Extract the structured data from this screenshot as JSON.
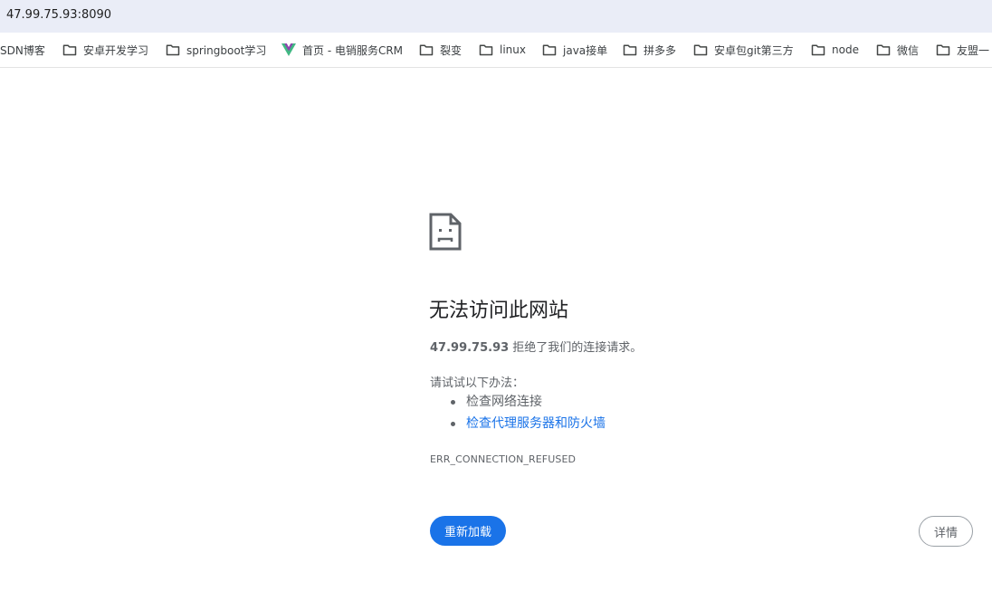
{
  "address_bar": {
    "url": "47.99.75.93:8090"
  },
  "bookmarks": [
    {
      "label": "SDN博客",
      "icon": "none"
    },
    {
      "label": "安卓开发学习",
      "icon": "folder-icon"
    },
    {
      "label": "springboot学习",
      "icon": "folder-icon"
    },
    {
      "label": "首页 - 电销服务CRM",
      "icon": "vue-logo-icon"
    },
    {
      "label": "裂变",
      "icon": "folder-icon"
    },
    {
      "label": "linux",
      "icon": "folder-icon"
    },
    {
      "label": "java接单",
      "icon": "folder-icon"
    },
    {
      "label": "拼多多",
      "icon": "folder-icon"
    },
    {
      "label": "安卓包git第三方",
      "icon": "folder-icon"
    },
    {
      "label": "node",
      "icon": "folder-icon"
    },
    {
      "label": "微信",
      "icon": "folder-icon"
    },
    {
      "label": "友盟一",
      "icon": "folder-icon"
    }
  ],
  "error_page": {
    "title": "无法访问此网站",
    "host": "47.99.75.93",
    "message": "拒绝了我们的连接请求。",
    "try_label": "请试试以下办法：",
    "suggestions": [
      {
        "text": "检查网络连接",
        "is_link": false
      },
      {
        "text": "检查代理服务器和防火墙",
        "is_link": true
      }
    ],
    "error_code": "ERR_CONNECTION_REFUSED",
    "reload_label": "重新加载",
    "details_label": "详情"
  },
  "colors": {
    "link": "#1a73e8",
    "primary_button": "#1a73e8",
    "address_bar_bg": "#eaedf7",
    "secondary_text": "#5f6368"
  }
}
